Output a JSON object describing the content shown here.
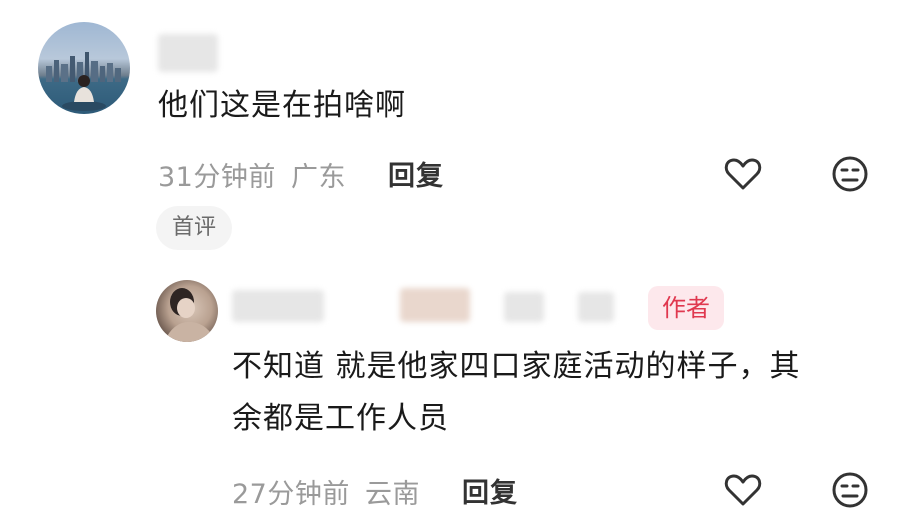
{
  "comments": [
    {
      "text": "他们这是在拍啥啊",
      "time": "31分钟前",
      "location": "广东",
      "reply_label": "回复",
      "badge": "首评",
      "icons": [
        "heart-outline-icon",
        "neutral-face-icon"
      ]
    },
    {
      "text_line1": "不知道 就是他家四口家庭活动的样子，其",
      "text_line2": "余都是工作人员",
      "time": "27分钟前",
      "location": "云南",
      "reply_label": "回复",
      "author_badge": "作者",
      "icons": [
        "heart-outline-icon",
        "neutral-face-icon"
      ]
    }
  ],
  "colors": {
    "author_badge_text": "#e0384f",
    "author_badge_bg": "#fde8ec",
    "meta_text": "#9a9a9a"
  }
}
